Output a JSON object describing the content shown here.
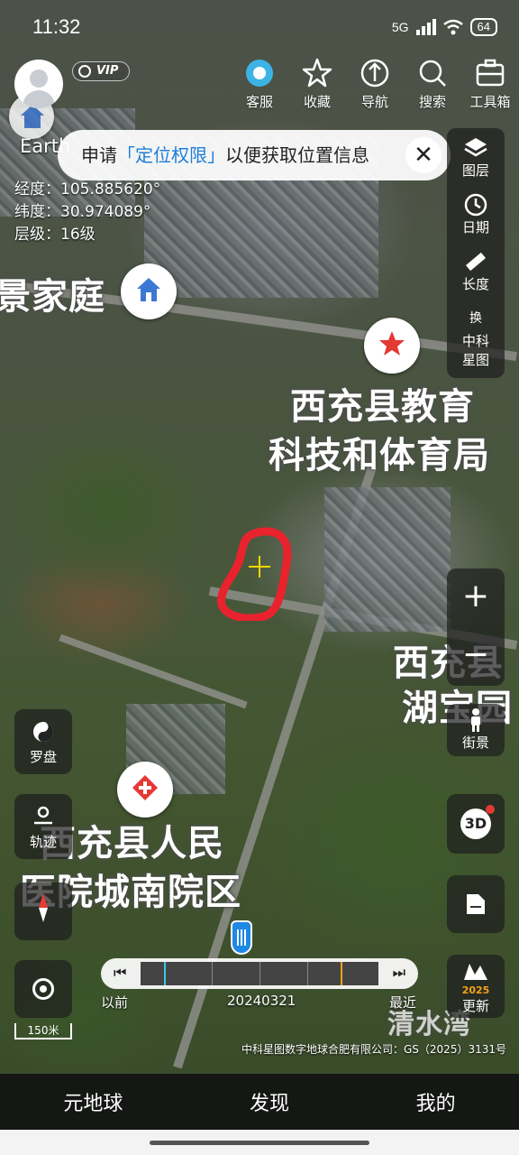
{
  "status_bar": {
    "time": "11:32",
    "network": "5G",
    "battery": "64"
  },
  "header": {
    "vip_badge": "VIP",
    "tools": [
      {
        "label": "客服",
        "icon": "customer-service-icon"
      },
      {
        "label": "收藏",
        "icon": "star-icon"
      },
      {
        "label": "导航",
        "icon": "navigation-icon"
      },
      {
        "label": "搜索",
        "icon": "search-icon"
      },
      {
        "label": "工具箱",
        "icon": "toolbox-icon"
      }
    ]
  },
  "banner": {
    "prefix": "申请",
    "highlight": "「定位权限」",
    "suffix": "以便获取位置信息",
    "close_symbol": "✕"
  },
  "earth_label": "Earth",
  "coords": {
    "lon": "经度：105.885620°",
    "lat": "纬度：30.974089°",
    "level": "层级：16级"
  },
  "right_panel": [
    {
      "label": "图层",
      "icon": "layers-icon"
    },
    {
      "label": "日期",
      "icon": "date-icon"
    },
    {
      "label": "长度",
      "icon": "ruler-icon"
    },
    {
      "label": "中科\n星图",
      "icon": "switch-map-icon",
      "badge": "换"
    }
  ],
  "zoom": {
    "in": "+",
    "out": "−"
  },
  "right_lower": [
    {
      "label": "街景",
      "icon": "street-view-icon"
    },
    {
      "label": "",
      "icon": "3d-icon",
      "text": "3D"
    },
    {
      "label": "",
      "icon": "document-icon"
    },
    {
      "label": "更新",
      "icon": "update-icon",
      "year": "2025"
    }
  ],
  "left_controls": [
    {
      "label": "罗盘",
      "icon": "taiji-compass-icon"
    },
    {
      "label": "轨迹",
      "icon": "track-icon"
    }
  ],
  "scale": "150米",
  "places": {
    "p1": "景家庭",
    "p2a": "西充县教育",
    "p2b": "科技和体育局",
    "p3a": "西充县",
    "p3b": "湖宝园",
    "p4a": "西充县人民",
    "p4b": "医院城南院区",
    "p5": "清水湾"
  },
  "timeline": {
    "left": "以前",
    "date": "20240321",
    "right": "最近"
  },
  "copyright": "中科星图数字地球合肥有限公司：GS（2025）3131号",
  "bottom_nav": [
    "元地球",
    "发现",
    "我的"
  ],
  "colors": {
    "accent_blue": "#1e7ed8",
    "marker_red": "#e53935",
    "crosshair": "#f5d500"
  }
}
